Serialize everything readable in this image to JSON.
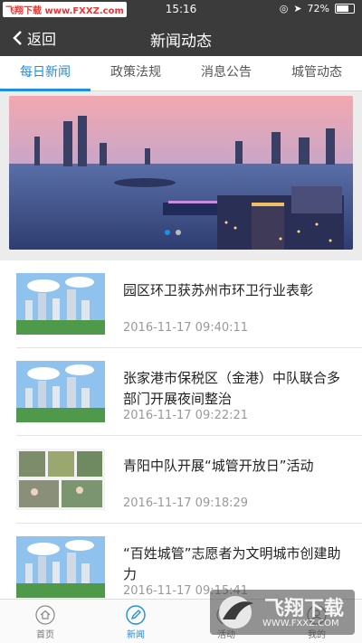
{
  "status_bar": {
    "site_badge": "飞翔下载 www.FXXZ.com",
    "time": "15:16",
    "battery": "72%"
  },
  "nav": {
    "back_label": "返回",
    "title": "新闻动态"
  },
  "tabs": [
    {
      "label": "每日新闻",
      "active": true
    },
    {
      "label": "政策法规",
      "active": false
    },
    {
      "label": "消息公告",
      "active": false
    },
    {
      "label": "城管动态",
      "active": false
    }
  ],
  "banner": {
    "slides": 2,
    "active_slide": 0
  },
  "news": [
    {
      "title": "园区环卫获苏州市环卫行业表彰",
      "date": "2016-11-17 09:40:11"
    },
    {
      "title": "张家港市保税区（金港）中队联合多部门开展夜间整治",
      "date": "2016-11-17 09:22:21"
    },
    {
      "title": "青阳中队开展“城管开放日”活动",
      "date": "2016-11-17 09:18:29"
    },
    {
      "title": "“百姓城管”志愿者为文明城市创建助力",
      "date": "2016-11-17 09:15:41"
    }
  ],
  "bottom_nav": [
    {
      "label": "首页",
      "icon": "home-icon"
    },
    {
      "label": "新闻",
      "icon": "pen-icon",
      "active": true
    },
    {
      "label": "活动",
      "icon": "activity-icon"
    },
    {
      "label": "我的",
      "icon": "profile-icon"
    }
  ],
  "watermark": {
    "text": "飞翔下载",
    "url": "WWW.FXXZ.COM"
  },
  "colors": {
    "accent": "#1a8fe3",
    "header": "#3b3b3b"
  }
}
